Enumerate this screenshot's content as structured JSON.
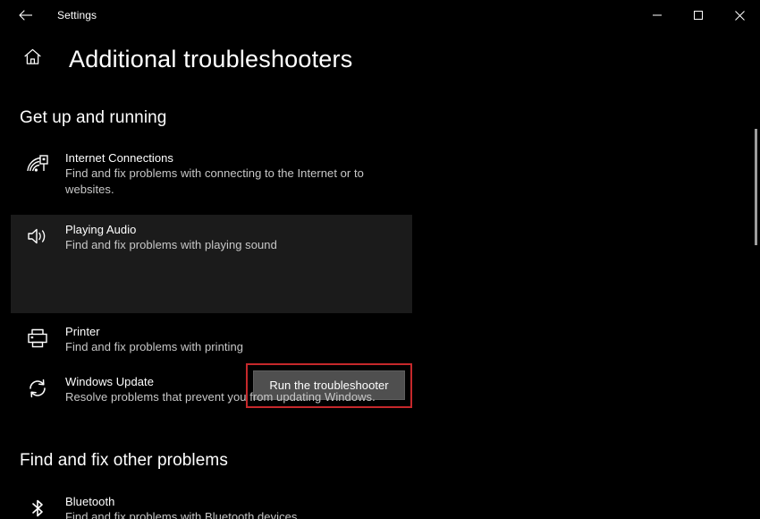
{
  "window": {
    "app_title": "Settings",
    "back_icon": "back-arrow-icon",
    "minimize_icon": "minimize-icon",
    "maximize_icon": "maximize-icon",
    "close_icon": "close-icon"
  },
  "header": {
    "home_icon": "home-icon",
    "title": "Additional troubleshooters"
  },
  "sections": [
    {
      "heading": "Get up and running",
      "items": [
        {
          "icon": "network-signal-icon",
          "title": "Internet Connections",
          "desc": "Find and fix problems with connecting to the Internet or to websites.",
          "selected": false
        },
        {
          "icon": "speaker-audio-icon",
          "title": "Playing Audio",
          "desc": "Find and fix problems with playing sound",
          "selected": true,
          "action_label": "Run the troubleshooter"
        },
        {
          "icon": "printer-icon",
          "title": "Printer",
          "desc": "Find and fix problems with printing",
          "selected": false
        },
        {
          "icon": "windows-update-refresh-icon",
          "title": "Windows Update",
          "desc": "Resolve problems that prevent you from updating Windows.",
          "selected": false
        }
      ]
    },
    {
      "heading": "Find and fix other problems",
      "items": [
        {
          "icon": "bluetooth-icon",
          "title": "Bluetooth",
          "desc": "Find and fix problems with Bluetooth devices",
          "selected": false
        }
      ]
    }
  ],
  "annotation": {
    "highlight_color": "#c5282b",
    "target": "run-the-troubleshooter-button"
  },
  "colors": {
    "background": "#000000",
    "selected_row": "#1b1b1b",
    "button": "#4f4f4f",
    "text_primary": "#ffffff",
    "text_secondary": "#c8c8c8",
    "scrollbar_thumb": "#9d9d9d"
  }
}
